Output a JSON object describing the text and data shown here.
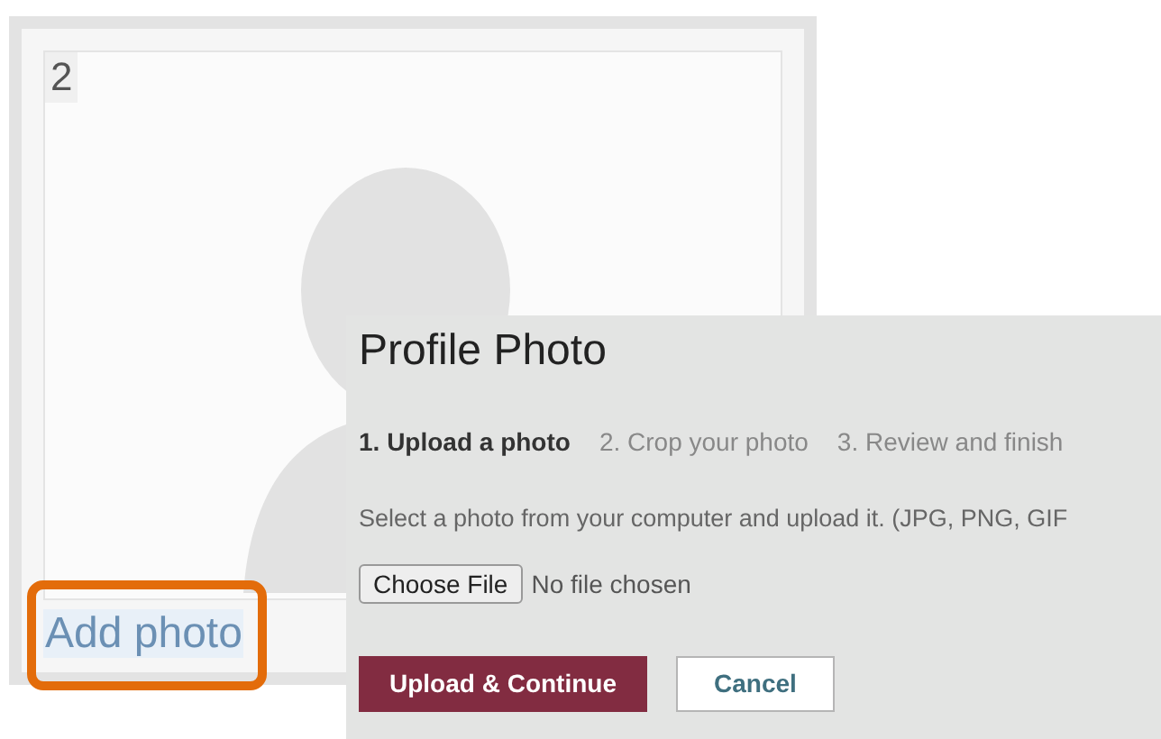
{
  "photo_card": {
    "number": "2",
    "add_photo_link": "Add photo",
    "highlighted": true
  },
  "dialog": {
    "title": "Profile Photo",
    "steps": [
      {
        "label": "1. Upload a photo",
        "selected": true
      },
      {
        "label": "2. Crop your photo",
        "selected": false
      },
      {
        "label": "3. Review and finish",
        "selected": false
      }
    ],
    "instructions": "Select a photo from your computer and upload it. (JPG, PNG, GIF",
    "file_input": {
      "button": "Choose File",
      "status": "No file chosen"
    },
    "buttons": [
      {
        "label": "Upload & Continue",
        "kind": "primary"
      },
      {
        "label": "Cancel",
        "kind": "secondary"
      }
    ]
  }
}
